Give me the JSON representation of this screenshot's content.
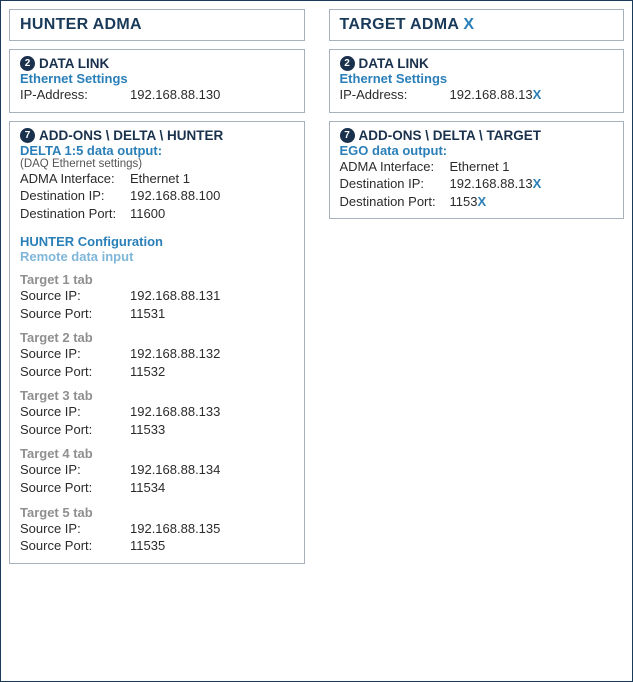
{
  "hunter": {
    "title": "HUNTER ADMA",
    "datalink": {
      "badge": "2",
      "heading": "DATA LINK",
      "sub": "Ethernet Settings",
      "ip_label": "IP-Address:",
      "ip_value": "192.168.88.130"
    },
    "addons": {
      "badge": "7",
      "heading": "ADD-ONS \\ DELTA \\ HUNTER",
      "delta_sub": "DELTA 1:5 data output:",
      "daq_note": "(DAQ Ethernet settings)",
      "iface_label": "ADMA Interface:",
      "iface_value": "Ethernet 1",
      "dip_label": "Destination IP:",
      "dip_value": "192.168.88.100",
      "dport_label": "Destination Port:",
      "dport_value": "11600",
      "hconf": "HUNTER Configuration",
      "remote": "Remote data input",
      "src_ip_label": "Source IP:",
      "src_port_label": "Source Port:",
      "targets": [
        {
          "tab": "Target 1 tab",
          "ip": "192.168.88.131",
          "port": "11531"
        },
        {
          "tab": "Target 2 tab",
          "ip": "192.168.88.132",
          "port": "11532"
        },
        {
          "tab": "Target 3 tab",
          "ip": "192.168.88.133",
          "port": "11533"
        },
        {
          "tab": "Target 4 tab",
          "ip": "192.168.88.134",
          "port": "11534"
        },
        {
          "tab": "Target 5 tab",
          "ip": "192.168.88.135",
          "port": "11535"
        }
      ]
    }
  },
  "target": {
    "title_prefix": "TARGET ADMA ",
    "title_x": "X",
    "datalink": {
      "badge": "2",
      "heading": "DATA LINK",
      "sub": "Ethernet Settings",
      "ip_label": "IP-Address:",
      "ip_prefix": "192.168.88.13",
      "ip_x": "X"
    },
    "addons": {
      "badge": "7",
      "heading": "ADD-ONS \\ DELTA \\ TARGET",
      "ego_sub": "EGO data output:",
      "iface_label": "ADMA Interface:",
      "iface_value": "Ethernet 1",
      "dip_label": "Destination IP:",
      "dip_prefix": "192.168.88.13",
      "dip_x": "X",
      "dport_label": "Destination Port:",
      "dport_prefix": "1153",
      "dport_x": "X"
    }
  }
}
